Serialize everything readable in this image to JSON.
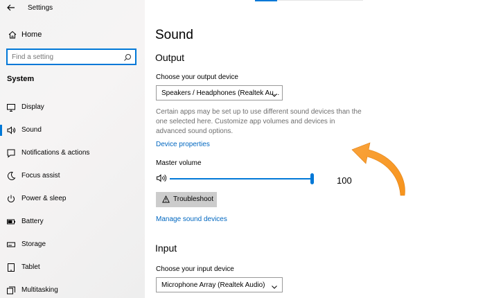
{
  "app": {
    "title": "Settings"
  },
  "sidebar": {
    "home_label": "Home",
    "search_placeholder": "Find a setting",
    "section": "System",
    "items": [
      {
        "label": "Display",
        "icon": "display-icon"
      },
      {
        "label": "Sound",
        "icon": "speaker-icon",
        "selected": true
      },
      {
        "label": "Notifications & actions",
        "icon": "notifications-icon"
      },
      {
        "label": "Focus assist",
        "icon": "moon-icon"
      },
      {
        "label": "Power & sleep",
        "icon": "power-icon"
      },
      {
        "label": "Battery",
        "icon": "battery-icon"
      },
      {
        "label": "Storage",
        "icon": "storage-icon"
      },
      {
        "label": "Tablet",
        "icon": "tablet-icon"
      },
      {
        "label": "Multitasking",
        "icon": "multitasking-icon"
      }
    ]
  },
  "main": {
    "title": "Sound",
    "output": {
      "heading": "Output",
      "choose_label": "Choose your output device",
      "device": "Speakers / Headphones (Realtek Au...",
      "description": "Certain apps may be set up to use different sound devices than the one selected here. Customize app volumes and devices in advanced sound options.",
      "device_properties_link": "Device properties",
      "volume_label": "Master volume",
      "volume_value": "100",
      "troubleshoot_label": "Troubleshoot",
      "manage_link": "Manage sound devices"
    },
    "input": {
      "heading": "Input",
      "choose_label": "Choose your input device",
      "device": "Microphone Array (Realtek Audio)"
    }
  },
  "colors": {
    "accent": "#0078d7",
    "link": "#0067c0",
    "annotation_arrow": "#f7941d"
  }
}
